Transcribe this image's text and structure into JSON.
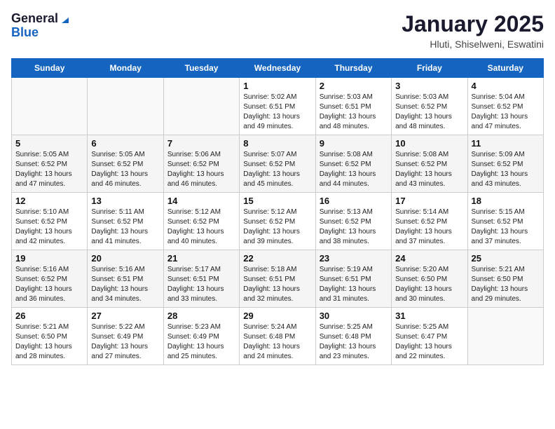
{
  "header": {
    "logo_general": "General",
    "logo_blue": "Blue",
    "title": "January 2025",
    "subtitle": "Hluti, Shiselweni, Eswatini"
  },
  "days_of_week": [
    "Sunday",
    "Monday",
    "Tuesday",
    "Wednesday",
    "Thursday",
    "Friday",
    "Saturday"
  ],
  "weeks": [
    [
      {
        "day": "",
        "info": ""
      },
      {
        "day": "",
        "info": ""
      },
      {
        "day": "",
        "info": ""
      },
      {
        "day": "1",
        "info": "Sunrise: 5:02 AM\nSunset: 6:51 PM\nDaylight: 13 hours and 49 minutes."
      },
      {
        "day": "2",
        "info": "Sunrise: 5:03 AM\nSunset: 6:51 PM\nDaylight: 13 hours and 48 minutes."
      },
      {
        "day": "3",
        "info": "Sunrise: 5:03 AM\nSunset: 6:52 PM\nDaylight: 13 hours and 48 minutes."
      },
      {
        "day": "4",
        "info": "Sunrise: 5:04 AM\nSunset: 6:52 PM\nDaylight: 13 hours and 47 minutes."
      }
    ],
    [
      {
        "day": "5",
        "info": "Sunrise: 5:05 AM\nSunset: 6:52 PM\nDaylight: 13 hours and 47 minutes."
      },
      {
        "day": "6",
        "info": "Sunrise: 5:05 AM\nSunset: 6:52 PM\nDaylight: 13 hours and 46 minutes."
      },
      {
        "day": "7",
        "info": "Sunrise: 5:06 AM\nSunset: 6:52 PM\nDaylight: 13 hours and 46 minutes."
      },
      {
        "day": "8",
        "info": "Sunrise: 5:07 AM\nSunset: 6:52 PM\nDaylight: 13 hours and 45 minutes."
      },
      {
        "day": "9",
        "info": "Sunrise: 5:08 AM\nSunset: 6:52 PM\nDaylight: 13 hours and 44 minutes."
      },
      {
        "day": "10",
        "info": "Sunrise: 5:08 AM\nSunset: 6:52 PM\nDaylight: 13 hours and 43 minutes."
      },
      {
        "day": "11",
        "info": "Sunrise: 5:09 AM\nSunset: 6:52 PM\nDaylight: 13 hours and 43 minutes."
      }
    ],
    [
      {
        "day": "12",
        "info": "Sunrise: 5:10 AM\nSunset: 6:52 PM\nDaylight: 13 hours and 42 minutes."
      },
      {
        "day": "13",
        "info": "Sunrise: 5:11 AM\nSunset: 6:52 PM\nDaylight: 13 hours and 41 minutes."
      },
      {
        "day": "14",
        "info": "Sunrise: 5:12 AM\nSunset: 6:52 PM\nDaylight: 13 hours and 40 minutes."
      },
      {
        "day": "15",
        "info": "Sunrise: 5:12 AM\nSunset: 6:52 PM\nDaylight: 13 hours and 39 minutes."
      },
      {
        "day": "16",
        "info": "Sunrise: 5:13 AM\nSunset: 6:52 PM\nDaylight: 13 hours and 38 minutes."
      },
      {
        "day": "17",
        "info": "Sunrise: 5:14 AM\nSunset: 6:52 PM\nDaylight: 13 hours and 37 minutes."
      },
      {
        "day": "18",
        "info": "Sunrise: 5:15 AM\nSunset: 6:52 PM\nDaylight: 13 hours and 37 minutes."
      }
    ],
    [
      {
        "day": "19",
        "info": "Sunrise: 5:16 AM\nSunset: 6:52 PM\nDaylight: 13 hours and 36 minutes."
      },
      {
        "day": "20",
        "info": "Sunrise: 5:16 AM\nSunset: 6:51 PM\nDaylight: 13 hours and 34 minutes."
      },
      {
        "day": "21",
        "info": "Sunrise: 5:17 AM\nSunset: 6:51 PM\nDaylight: 13 hours and 33 minutes."
      },
      {
        "day": "22",
        "info": "Sunrise: 5:18 AM\nSunset: 6:51 PM\nDaylight: 13 hours and 32 minutes."
      },
      {
        "day": "23",
        "info": "Sunrise: 5:19 AM\nSunset: 6:51 PM\nDaylight: 13 hours and 31 minutes."
      },
      {
        "day": "24",
        "info": "Sunrise: 5:20 AM\nSunset: 6:50 PM\nDaylight: 13 hours and 30 minutes."
      },
      {
        "day": "25",
        "info": "Sunrise: 5:21 AM\nSunset: 6:50 PM\nDaylight: 13 hours and 29 minutes."
      }
    ],
    [
      {
        "day": "26",
        "info": "Sunrise: 5:21 AM\nSunset: 6:50 PM\nDaylight: 13 hours and 28 minutes."
      },
      {
        "day": "27",
        "info": "Sunrise: 5:22 AM\nSunset: 6:49 PM\nDaylight: 13 hours and 27 minutes."
      },
      {
        "day": "28",
        "info": "Sunrise: 5:23 AM\nSunset: 6:49 PM\nDaylight: 13 hours and 25 minutes."
      },
      {
        "day": "29",
        "info": "Sunrise: 5:24 AM\nSunset: 6:48 PM\nDaylight: 13 hours and 24 minutes."
      },
      {
        "day": "30",
        "info": "Sunrise: 5:25 AM\nSunset: 6:48 PM\nDaylight: 13 hours and 23 minutes."
      },
      {
        "day": "31",
        "info": "Sunrise: 5:25 AM\nSunset: 6:47 PM\nDaylight: 13 hours and 22 minutes."
      },
      {
        "day": "",
        "info": ""
      }
    ]
  ]
}
